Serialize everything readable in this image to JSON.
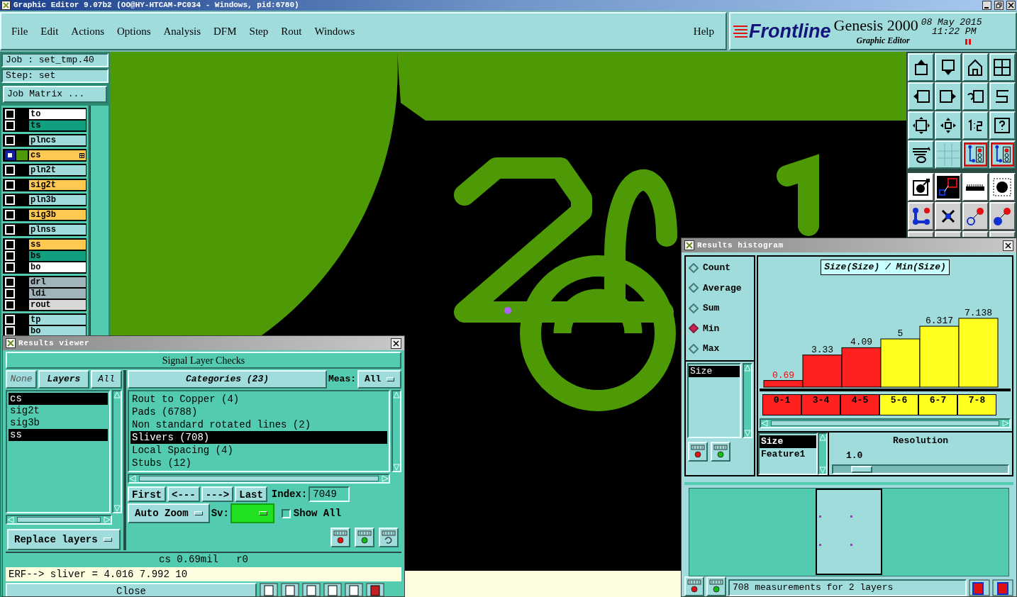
{
  "window": {
    "title": "Graphic Editor 9.07b2 (OO@HY-HTCAM-PC034 - Windows, pid:6780)"
  },
  "menu": [
    "File",
    "Edit",
    "Actions",
    "Options",
    "Analysis",
    "DFM",
    "Step",
    "Rout",
    "Windows"
  ],
  "help": "Help",
  "brand": {
    "logo": "Frontline",
    "product": "Genesis 2000",
    "subtitle": "Graphic Editor",
    "date": "08 May 2015",
    "time": "11:22 PM"
  },
  "job": {
    "job": "Job : set_tmp.40",
    "step": "Step: set",
    "matrix_button": "Job Matrix ..."
  },
  "layer_groups": [
    [
      {
        "name": "to",
        "color": "#ffffff",
        "active": false
      },
      {
        "name": "ts",
        "color": "#10a080",
        "active": false
      }
    ],
    [
      {
        "name": "plncs",
        "color": "#a0dcdc",
        "active": false
      }
    ],
    [
      {
        "name": "cs",
        "color": "#ffc850",
        "active": true
      }
    ],
    [
      {
        "name": "pln2t",
        "color": "#a0dcdc",
        "active": false
      }
    ],
    [
      {
        "name": "sig2t",
        "color": "#ffc850",
        "active": false
      }
    ],
    [
      {
        "name": "pln3b",
        "color": "#a0dcdc",
        "active": false
      }
    ],
    [
      {
        "name": "sig3b",
        "color": "#ffc850",
        "active": false
      }
    ],
    [
      {
        "name": "plnss",
        "color": "#a0dcdc",
        "active": false
      }
    ],
    [
      {
        "name": "ss",
        "color": "#ffc850",
        "active": false
      },
      {
        "name": "bs",
        "color": "#10a080",
        "active": false
      },
      {
        "name": "bo",
        "color": "#ffffff",
        "active": false
      }
    ],
    [
      {
        "name": "drl",
        "color": "#a0b4bc",
        "active": false
      },
      {
        "name": "ldi",
        "color": "#a0b4bc",
        "active": false
      },
      {
        "name": "rout",
        "color": "#d8d8d8",
        "active": false
      }
    ],
    [
      {
        "name": "tp",
        "color": "#a0dcdc",
        "active": false
      },
      {
        "name": "bo",
        "color": "#a0dcdc",
        "active": false
      }
    ]
  ],
  "results_viewer": {
    "title": "Results viewer",
    "header": "Signal Layer Checks",
    "layer_filters": [
      {
        "label": "None",
        "selected": false,
        "disabled": true
      },
      {
        "label": "Layers",
        "selected": true,
        "disabled": false
      },
      {
        "label": "All",
        "selected": false,
        "disabled": false
      }
    ],
    "layers": [
      {
        "name": "cs",
        "selected": true
      },
      {
        "name": "sig2t",
        "selected": false
      },
      {
        "name": "sig3b",
        "selected": false
      },
      {
        "name": "ss",
        "selected": true
      }
    ],
    "categories_header": "Categories (23)",
    "meas_label": "Meas:",
    "meas_value": "All",
    "categories": [
      {
        "label": "Rout to Copper (4)",
        "selected": false
      },
      {
        "label": "Pads (6788)",
        "selected": false
      },
      {
        "label": "Non standard rotated lines (2)",
        "selected": false
      },
      {
        "label": "Slivers (708)",
        "selected": true
      },
      {
        "label": "Local Spacing (4)",
        "selected": false
      },
      {
        "label": "Stubs (12)",
        "selected": false
      }
    ],
    "nav_buttons": [
      "First",
      "<---",
      "--->",
      "Last"
    ],
    "index_label": "Index:",
    "index_value": "7049",
    "zoom_mode": "Auto Zoom",
    "sv_label": "Sv:",
    "show_all": {
      "label": "Show All",
      "checked": false
    },
    "replace_button": "Replace layers",
    "status": "cs 0.69mil   r0",
    "erf_line": "ERF--> sliver = 4.016 7.992 10",
    "close_button": "Close"
  },
  "histogram": {
    "title": "Results histogram",
    "modes": [
      {
        "label": "Count",
        "selected": false
      },
      {
        "label": "Average",
        "selected": false
      },
      {
        "label": "Sum",
        "selected": false
      },
      {
        "label": "Min",
        "selected": true
      },
      {
        "label": "Max",
        "selected": false
      }
    ],
    "attributes": [
      {
        "label": "Size",
        "selected": true
      }
    ],
    "chart_data": {
      "type": "bar",
      "title": "Size(Size) / Min(Size)",
      "categories": [
        "0-1",
        "3-4",
        "4-5",
        "5-6",
        "6-7",
        "7-8"
      ],
      "series": [
        {
          "color": "#ff2020",
          "values": [
            0.69,
            3.33,
            4.09,
            null,
            null,
            null
          ]
        },
        {
          "color": "#ffff20",
          "values": [
            null,
            null,
            null,
            5,
            6.317,
            7.138
          ]
        }
      ],
      "data_labels": true
    },
    "fields": [
      {
        "label": "Size",
        "selected": true
      },
      {
        "label": "Feature1",
        "selected": false
      }
    ],
    "resolution_label": "Resolution",
    "resolution_value": "1.0",
    "resolution": {
      "level": 0.1
    },
    "summary": "708 measurements for 2 layers"
  }
}
